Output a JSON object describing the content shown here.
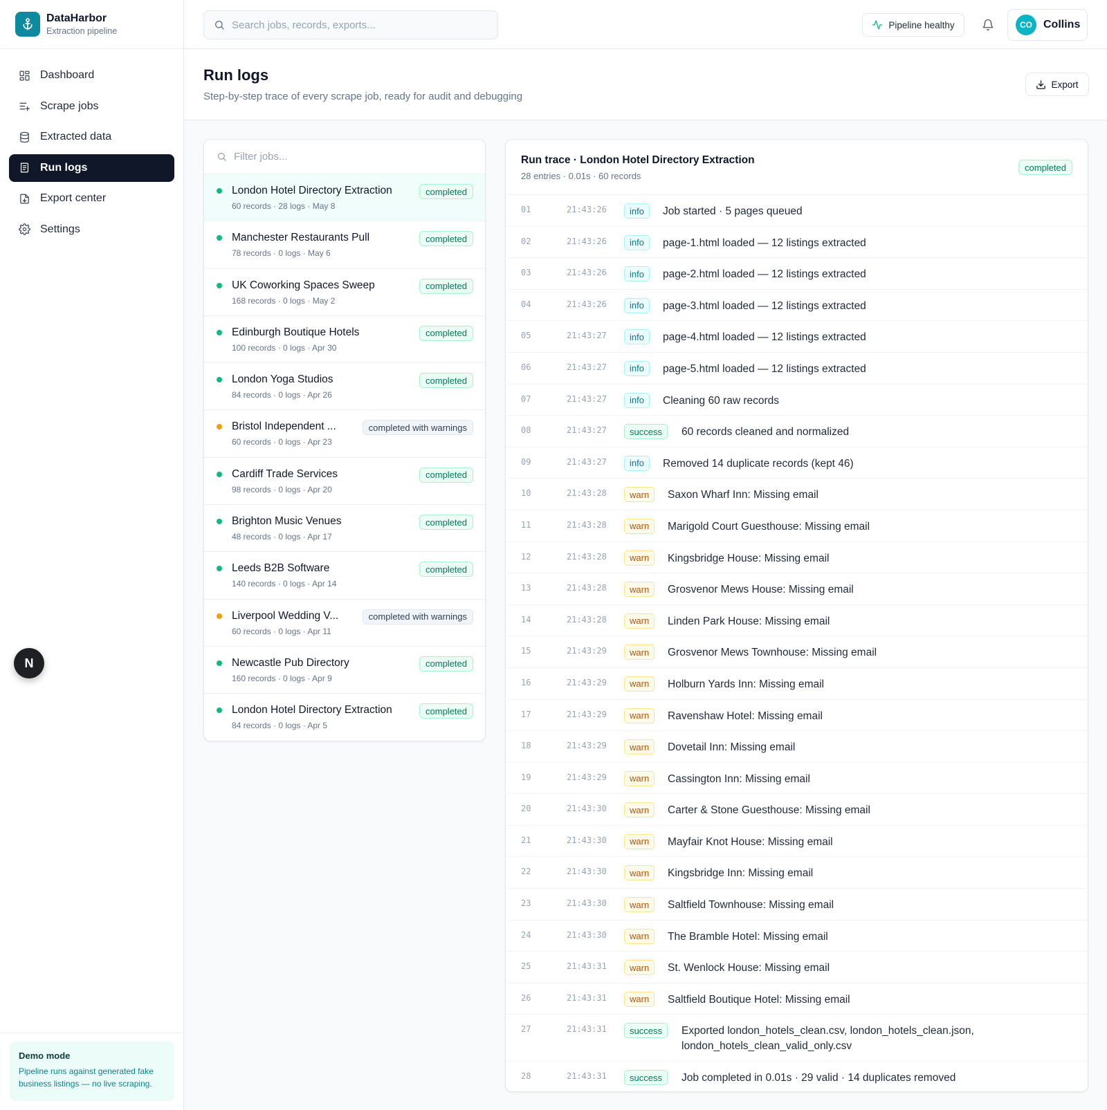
{
  "brand": {
    "name": "DataHarbor",
    "subtitle": "Extraction pipeline"
  },
  "sidebar": {
    "items": [
      {
        "label": "Dashboard",
        "icon": "dashboard-icon",
        "active": false
      },
      {
        "label": "Scrape jobs",
        "icon": "list-plus-icon",
        "active": false
      },
      {
        "label": "Extracted data",
        "icon": "database-icon",
        "active": false
      },
      {
        "label": "Run logs",
        "icon": "logs-icon",
        "active": true
      },
      {
        "label": "Export center",
        "icon": "file-export-icon",
        "active": false
      },
      {
        "label": "Settings",
        "icon": "gear-icon",
        "active": false
      }
    ],
    "fab_label": "N",
    "demo": {
      "title": "Demo mode",
      "text": "Pipeline runs against generated fake business listings — no live scraping."
    }
  },
  "topbar": {
    "search_placeholder": "Search jobs, records, exports...",
    "pipeline_status": "Pipeline healthy",
    "user": {
      "initials": "CO",
      "name": "Collins"
    }
  },
  "page": {
    "title": "Run logs",
    "subtitle": "Step-by-step trace of every scrape job, ready for audit and debugging",
    "export_label": "Export"
  },
  "jobs": {
    "filter_placeholder": "Filter jobs...",
    "items": [
      {
        "name": "London Hotel Directory Extraction",
        "meta": "60 records · 28 logs · May 8",
        "status": "completed",
        "kind": "ok",
        "selected": true
      },
      {
        "name": "Manchester Restaurants Pull",
        "meta": "78 records · 0 logs · May 6",
        "status": "completed",
        "kind": "ok"
      },
      {
        "name": "UK Coworking Spaces Sweep",
        "meta": "168 records · 0 logs · May 2",
        "status": "completed",
        "kind": "ok"
      },
      {
        "name": "Edinburgh Boutique Hotels",
        "meta": "100 records · 0 logs · Apr 30",
        "status": "completed",
        "kind": "ok"
      },
      {
        "name": "London Yoga Studios",
        "meta": "84 records · 0 logs · Apr 26",
        "status": "completed",
        "kind": "ok"
      },
      {
        "name": "Bristol Independent ...",
        "meta": "60 records · 0 logs · Apr 23",
        "status": "completed with warnings",
        "kind": "warn"
      },
      {
        "name": "Cardiff Trade Services",
        "meta": "98 records · 0 logs · Apr 20",
        "status": "completed",
        "kind": "ok"
      },
      {
        "name": "Brighton Music Venues",
        "meta": "48 records · 0 logs · Apr 17",
        "status": "completed",
        "kind": "ok"
      },
      {
        "name": "Leeds B2B Software",
        "meta": "140 records · 0 logs · Apr 14",
        "status": "completed",
        "kind": "ok"
      },
      {
        "name": "Liverpool Wedding V...",
        "meta": "60 records · 0 logs · Apr 11",
        "status": "completed with warnings",
        "kind": "warn"
      },
      {
        "name": "Newcastle Pub Directory",
        "meta": "160 records · 0 logs · Apr 9",
        "status": "completed",
        "kind": "ok"
      },
      {
        "name": "London Hotel Directory Extraction",
        "meta": "84 records · 0 logs · Apr 5",
        "status": "completed",
        "kind": "ok"
      }
    ]
  },
  "trace": {
    "title": "Run trace · London Hotel Directory Extraction",
    "subtitle": "28 entries · 0.01s · 60 records",
    "status": "completed",
    "entries": [
      {
        "n": "01",
        "time": "21:43:26",
        "level": "info",
        "message": "Job started · 5 pages queued"
      },
      {
        "n": "02",
        "time": "21:43:26",
        "level": "info",
        "message": "page-1.html loaded — 12 listings extracted"
      },
      {
        "n": "03",
        "time": "21:43:26",
        "level": "info",
        "message": "page-2.html loaded — 12 listings extracted"
      },
      {
        "n": "04",
        "time": "21:43:26",
        "level": "info",
        "message": "page-3.html loaded — 12 listings extracted"
      },
      {
        "n": "05",
        "time": "21:43:27",
        "level": "info",
        "message": "page-4.html loaded — 12 listings extracted"
      },
      {
        "n": "06",
        "time": "21:43:27",
        "level": "info",
        "message": "page-5.html loaded — 12 listings extracted"
      },
      {
        "n": "07",
        "time": "21:43:27",
        "level": "info",
        "message": "Cleaning 60 raw records"
      },
      {
        "n": "08",
        "time": "21:43:27",
        "level": "success",
        "message": "60 records cleaned and normalized"
      },
      {
        "n": "09",
        "time": "21:43:27",
        "level": "info",
        "message": "Removed 14 duplicate records (kept 46)"
      },
      {
        "n": "10",
        "time": "21:43:28",
        "level": "warn",
        "message": "Saxon Wharf Inn: Missing email"
      },
      {
        "n": "11",
        "time": "21:43:28",
        "level": "warn",
        "message": "Marigold Court Guesthouse: Missing email"
      },
      {
        "n": "12",
        "time": "21:43:28",
        "level": "warn",
        "message": "Kingsbridge House: Missing email"
      },
      {
        "n": "13",
        "time": "21:43:28",
        "level": "warn",
        "message": "Grosvenor Mews House: Missing email"
      },
      {
        "n": "14",
        "time": "21:43:28",
        "level": "warn",
        "message": "Linden Park House: Missing email"
      },
      {
        "n": "15",
        "time": "21:43:29",
        "level": "warn",
        "message": "Grosvenor Mews Townhouse: Missing email"
      },
      {
        "n": "16",
        "time": "21:43:29",
        "level": "warn",
        "message": "Holburn Yards Inn: Missing email"
      },
      {
        "n": "17",
        "time": "21:43:29",
        "level": "warn",
        "message": "Ravenshaw Hotel: Missing email"
      },
      {
        "n": "18",
        "time": "21:43:29",
        "level": "warn",
        "message": "Dovetail Inn: Missing email"
      },
      {
        "n": "19",
        "time": "21:43:29",
        "level": "warn",
        "message": "Cassington Inn: Missing email"
      },
      {
        "n": "20",
        "time": "21:43:30",
        "level": "warn",
        "message": "Carter & Stone Guesthouse: Missing email"
      },
      {
        "n": "21",
        "time": "21:43:30",
        "level": "warn",
        "message": "Mayfair Knot House: Missing email"
      },
      {
        "n": "22",
        "time": "21:43:30",
        "level": "warn",
        "message": "Kingsbridge Inn: Missing email"
      },
      {
        "n": "23",
        "time": "21:43:30",
        "level": "warn",
        "message": "Saltfield Townhouse: Missing email"
      },
      {
        "n": "24",
        "time": "21:43:30",
        "level": "warn",
        "message": "The Bramble Hotel: Missing email"
      },
      {
        "n": "25",
        "time": "21:43:31",
        "level": "warn",
        "message": "St. Wenlock House: Missing email"
      },
      {
        "n": "26",
        "time": "21:43:31",
        "level": "warn",
        "message": "Saltfield Boutique Hotel: Missing email"
      },
      {
        "n": "27",
        "time": "21:43:31",
        "level": "success",
        "message": "Exported london_hotels_clean.csv, london_hotels_clean.json, london_hotels_clean_valid_only.csv"
      },
      {
        "n": "28",
        "time": "21:43:31",
        "level": "success",
        "message": "Job completed in 0.01s · 29 valid · 14 duplicates removed"
      }
    ]
  },
  "colors": {
    "accent": "#0e8a9e",
    "nav_active": "#0f1729",
    "dot_ok": "#10b981",
    "dot_warn": "#f59e0b"
  }
}
